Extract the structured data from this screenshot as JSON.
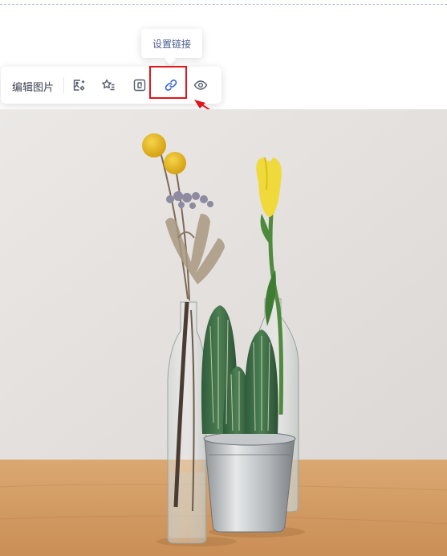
{
  "toolbar": {
    "edit_image_label": "编辑图片",
    "buttons": [
      {
        "name": "replace-image-icon"
      },
      {
        "name": "star-list-icon"
      },
      {
        "name": "crop-icon"
      },
      {
        "name": "link-icon"
      },
      {
        "name": "eye-icon"
      }
    ]
  },
  "tooltip": {
    "text": "设置链接"
  },
  "colors": {
    "highlight": "#e3141b",
    "active_icon": "#3a66d6",
    "icon": "#555b6e",
    "wall": "#e8e5e3",
    "table": "#d49d62"
  }
}
